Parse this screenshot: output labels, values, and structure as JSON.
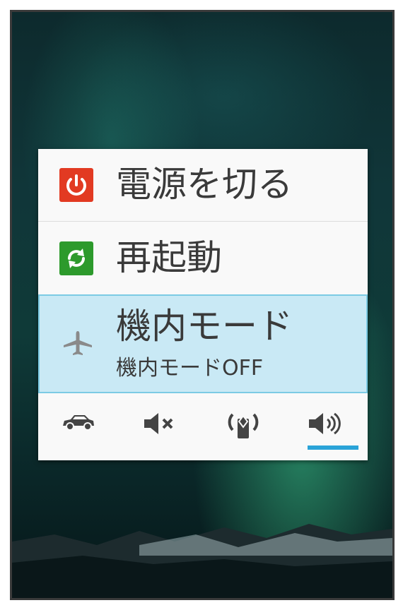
{
  "menu": {
    "power_off": {
      "label": "電源を切る",
      "icon": "power-icon",
      "icon_color": "#e23a22"
    },
    "restart": {
      "label": "再起動",
      "icon": "restart-icon",
      "icon_color": "#2d9a2c"
    },
    "airplane": {
      "label": "機内モード",
      "status": "機内モードOFF",
      "icon": "airplane-icon",
      "highlight_color": "#c9e9f5"
    }
  },
  "sound_modes": [
    {
      "name": "drive-mode",
      "icon": "car-icon"
    },
    {
      "name": "silent",
      "icon": "mute-icon"
    },
    {
      "name": "vibrate",
      "icon": "vibrate-icon"
    },
    {
      "name": "sound-on",
      "icon": "speaker-icon",
      "selected": true
    }
  ],
  "colors": {
    "selected_indicator": "#2aa3d8"
  }
}
